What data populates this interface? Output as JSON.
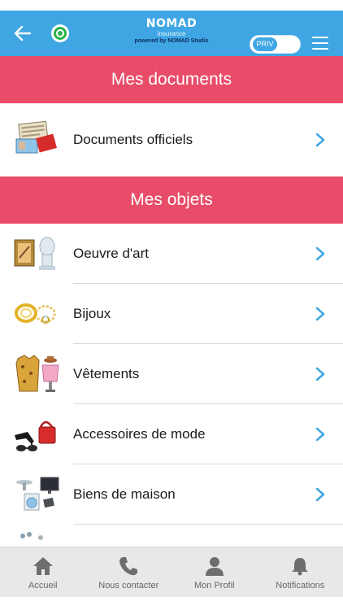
{
  "header": {
    "brand_name": "NOMAD",
    "brand_sub": "insurance",
    "brand_powered": "powered by NOMAD Studio",
    "toggle_label": "PRIV"
  },
  "sections": {
    "documents_title": "Mes documents",
    "objects_title": "Mes objets"
  },
  "documents": [
    {
      "label": "Documents officiels",
      "icon": "documents-icon"
    }
  ],
  "objects": [
    {
      "label": "Oeuvre d'art",
      "icon": "artwork-icon"
    },
    {
      "label": "Bijoux",
      "icon": "jewelry-icon"
    },
    {
      "label": "Vêtements",
      "icon": "clothing-icon"
    },
    {
      "label": "Accessoires de mode",
      "icon": "fashion-accessories-icon"
    },
    {
      "label": "Biens de maison",
      "icon": "household-goods-icon"
    }
  ],
  "tabbar": [
    {
      "label": "Accueil",
      "icon": "home-icon"
    },
    {
      "label": "Nous contacter",
      "icon": "phone-icon"
    },
    {
      "label": "Mon Profil",
      "icon": "profile-icon"
    },
    {
      "label": "Notifications",
      "icon": "bell-icon"
    }
  ],
  "colors": {
    "topbar": "#3fa6e3",
    "section_header": "#e84c68",
    "chevron": "#3fa6e3",
    "status_green": "#2db34a"
  }
}
